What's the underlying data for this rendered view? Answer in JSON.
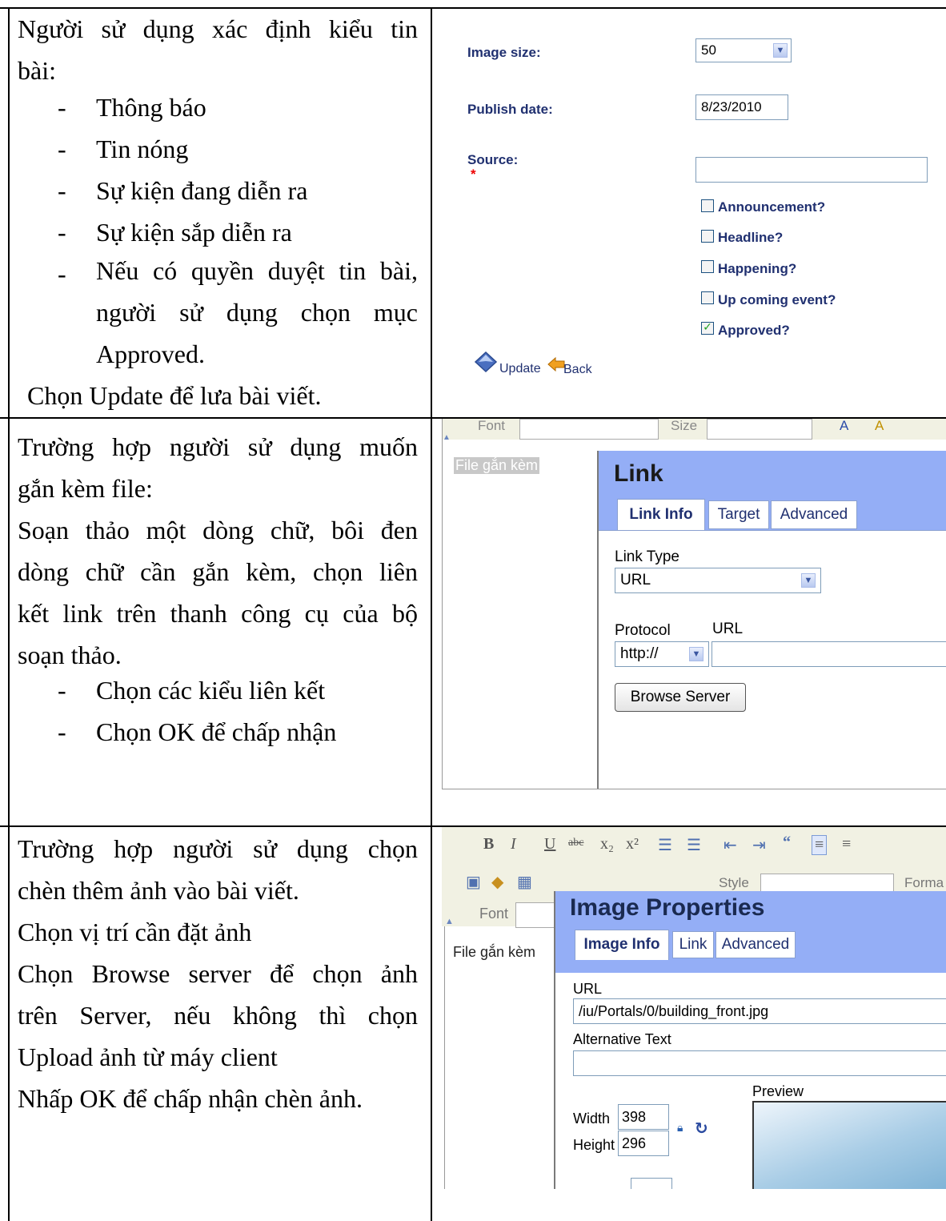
{
  "row1": {
    "left": {
      "intro_line1": "Người sử dụng xác định kiểu tin",
      "intro_line2": "bài:",
      "bullets": [
        "Thông báo",
        "Tin nóng",
        "Sự kiện đang diễn ra",
        "Sự kiện sắp diễn ra"
      ],
      "bullet5_line1": "Nếu có quyền duyệt tin bài,",
      "bullet5_line2": "người sử dụng chọn mục",
      "bullet5_line3": "Approved.",
      "closing": "Chọn Update để lưa bài viết."
    },
    "form": {
      "image_size_label": "Image size:",
      "image_size_value": "50",
      "publish_date_label": "Publish date:",
      "publish_date_value": "8/23/2010",
      "source_label": "Source:",
      "required_mark": "*",
      "checkboxes": [
        {
          "label": "Announcement?",
          "checked": false
        },
        {
          "label": "Headline?",
          "checked": false
        },
        {
          "label": "Happening?",
          "checked": false
        },
        {
          "label": "Up coming event?",
          "checked": false
        },
        {
          "label": "Approved?",
          "checked": true
        }
      ],
      "update_label": "Update",
      "back_label": "Back"
    }
  },
  "row2": {
    "left": {
      "line1": "Trường hợp người sử dụng muốn",
      "line2": "gắn kèm file:",
      "line3": "Soạn thảo một dòng chữ, bôi đen",
      "line4": "dòng chữ cần gắn kèm, chọn liên",
      "line5": "kết link trên thanh công cụ của bộ",
      "line6": "soạn thảo.",
      "bullets": [
        "Chọn các kiểu liên kết",
        "Chọn OK để chấp nhận"
      ]
    },
    "editor": {
      "toolbar_font": "Font",
      "toolbar_size": "Size",
      "selected_text": "File gắn kèm"
    },
    "dialog": {
      "title": "Link",
      "tabs": [
        "Link Info",
        "Target",
        "Advanced"
      ],
      "link_type_label": "Link Type",
      "link_type_value": "URL",
      "protocol_label": "Protocol",
      "protocol_value": "http://",
      "url_label": "URL",
      "browse_button": "Browse Server"
    }
  },
  "row3": {
    "left": {
      "line1": "Trường hợp người sử dụng chọn",
      "line2": "chèn thêm ảnh vào bài viết.",
      "line3": "Chọn vị trí cần đặt ảnh",
      "line4": "Chọn Browse server để chọn ảnh",
      "line5": "trên Server, nếu không thì chọn",
      "line6": "Upload ảnh từ máy client",
      "line7": "Nhấp OK để chấp nhận chèn ảnh."
    },
    "editor": {
      "toolbar_style": "Style",
      "toolbar_format": "Forma",
      "toolbar_font": "Font",
      "body_text": "File gắn kèm"
    },
    "dialog": {
      "title": "Image Properties",
      "tabs": [
        "Image Info",
        "Link",
        "Advanced"
      ],
      "url_label": "URL",
      "url_value": "/iu/Portals/0/building_front.jpg",
      "alt_label": "Alternative Text",
      "preview_label": "Preview",
      "width_label": "Width",
      "width_value": "398",
      "height_label": "Height",
      "height_value": "296"
    }
  }
}
